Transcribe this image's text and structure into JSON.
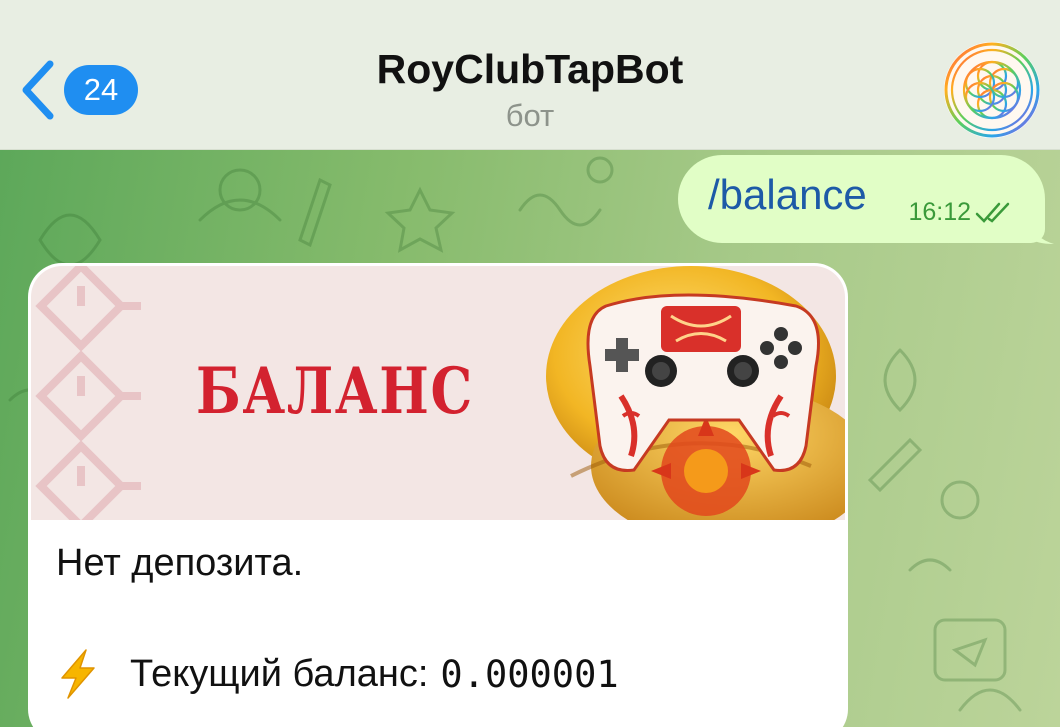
{
  "header": {
    "back_badge": "24",
    "title": "RoyClubTapBot",
    "subtitle": "бот"
  },
  "outgoing": {
    "text": "/balance",
    "time": "16:12",
    "status_icon": "double-check-icon"
  },
  "card": {
    "banner_title": "БАЛАНС",
    "deposit_text": "Нет депозита.",
    "balance_label": "Текущий баланс:",
    "balance_value": "0.000001",
    "balance_icon": "lightning-icon"
  },
  "colors": {
    "accent": "#1f8ef1",
    "outgoing_bubble": "#e1fec6",
    "banner_title": "#d3222f"
  }
}
